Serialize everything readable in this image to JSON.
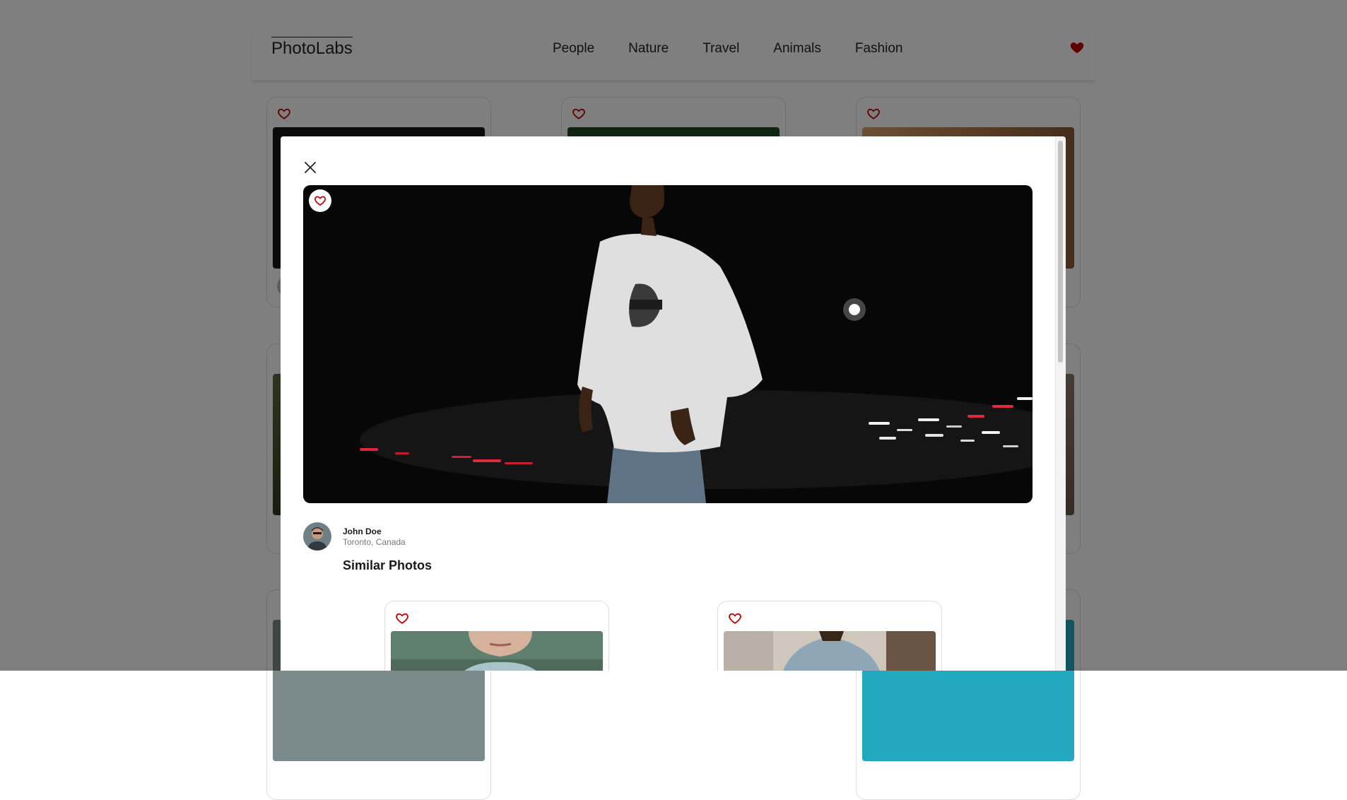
{
  "app": {
    "logo": "PhotoLabs"
  },
  "nav": {
    "topics": [
      "People",
      "Nature",
      "Travel",
      "Animals",
      "Fashion"
    ],
    "fav_icon": "heart-filled-icon"
  },
  "colors": {
    "accent": "#c00000",
    "overlay": "rgba(0,0,0,0.5)"
  },
  "modal": {
    "close_icon": "close-icon",
    "photo_fav_icon": "heart-outline-icon",
    "author": {
      "name": "John Doe",
      "location": "Toronto, Canada"
    },
    "similar_title": "Similar Photos"
  }
}
